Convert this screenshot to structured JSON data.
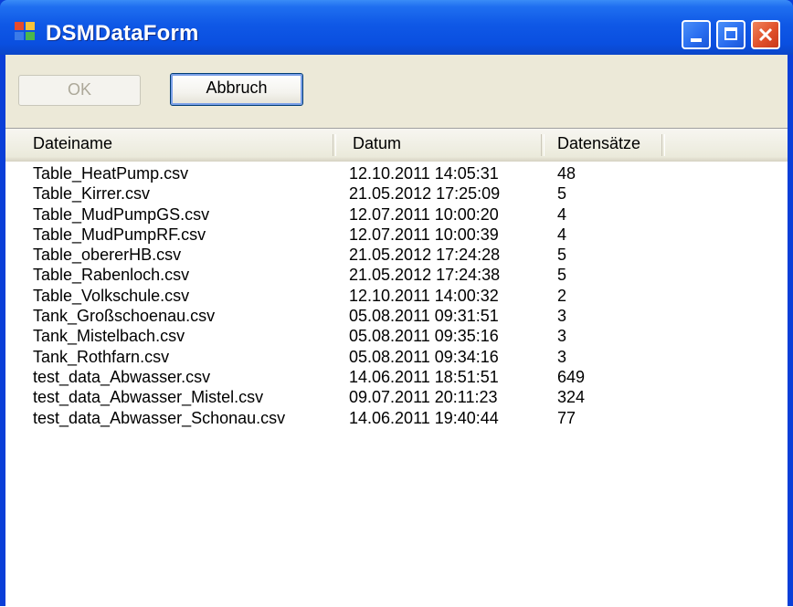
{
  "window": {
    "title": "DSMDataForm"
  },
  "toolbar": {
    "ok_label": "OK",
    "cancel_label": "Abbruch"
  },
  "list": {
    "columns": [
      "Dateiname",
      "Datum",
      "Datensätze"
    ],
    "rows": [
      [
        "Table_HeatPump.csv",
        "12.10.2011 14:05:31",
        "48"
      ],
      [
        "Table_Kirrer.csv",
        "21.05.2012 17:25:09",
        "5"
      ],
      [
        "Table_MudPumpGS.csv",
        "12.07.2011 10:00:20",
        "4"
      ],
      [
        "Table_MudPumpRF.csv",
        "12.07.2011 10:00:39",
        "4"
      ],
      [
        "Table_obererHB.csv",
        "21.05.2012 17:24:28",
        "5"
      ],
      [
        "Table_Rabenloch.csv",
        "21.05.2012 17:24:38",
        "5"
      ],
      [
        "Table_Volkschule.csv",
        "12.10.2011 14:00:32",
        "2"
      ],
      [
        "Tank_Großschoenau.csv",
        "05.08.2011 09:31:51",
        "3"
      ],
      [
        "Tank_Mistelbach.csv",
        "05.08.2011 09:35:16",
        "3"
      ],
      [
        "Tank_Rothfarn.csv",
        "05.08.2011 09:34:16",
        "3"
      ],
      [
        "test_data_Abwasser.csv",
        "14.06.2011 18:51:51",
        "649"
      ],
      [
        "test_data_Abwasser_Mistel.csv",
        "09.07.2011 20:11:23",
        "324"
      ],
      [
        "test_data_Abwasser_Schonau.csv",
        "14.06.2011 19:40:44",
        "77"
      ]
    ]
  }
}
